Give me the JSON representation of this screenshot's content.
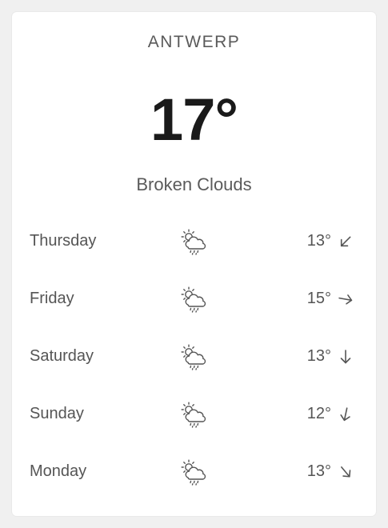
{
  "location": {
    "city": "ANTWERP"
  },
  "current": {
    "temperature": "17°",
    "condition": "Broken Clouds"
  },
  "forecast": [
    {
      "day": "Thursday",
      "icon": "partly-cloudy-rain-icon",
      "temp": "13°",
      "wind_direction": "down-left",
      "wind_rotation_deg": 45
    },
    {
      "day": "Friday",
      "icon": "partly-cloudy-rain-icon",
      "temp": "15°",
      "wind_direction": "right",
      "wind_rotation_deg": -80
    },
    {
      "day": "Saturday",
      "icon": "partly-cloudy-rain-icon",
      "temp": "13°",
      "wind_direction": "down",
      "wind_rotation_deg": 0
    },
    {
      "day": "Sunday",
      "icon": "partly-cloudy-rain-icon",
      "temp": "12°",
      "wind_direction": "down",
      "wind_rotation_deg": 12
    },
    {
      "day": "Monday",
      "icon": "partly-cloudy-rain-icon",
      "temp": "13°",
      "wind_direction": "down-right",
      "wind_rotation_deg": -40
    }
  ],
  "colors": {
    "background": "#f0f0f0",
    "card": "#ffffff",
    "text_primary": "#1a1a1a",
    "text_secondary": "#555555"
  }
}
